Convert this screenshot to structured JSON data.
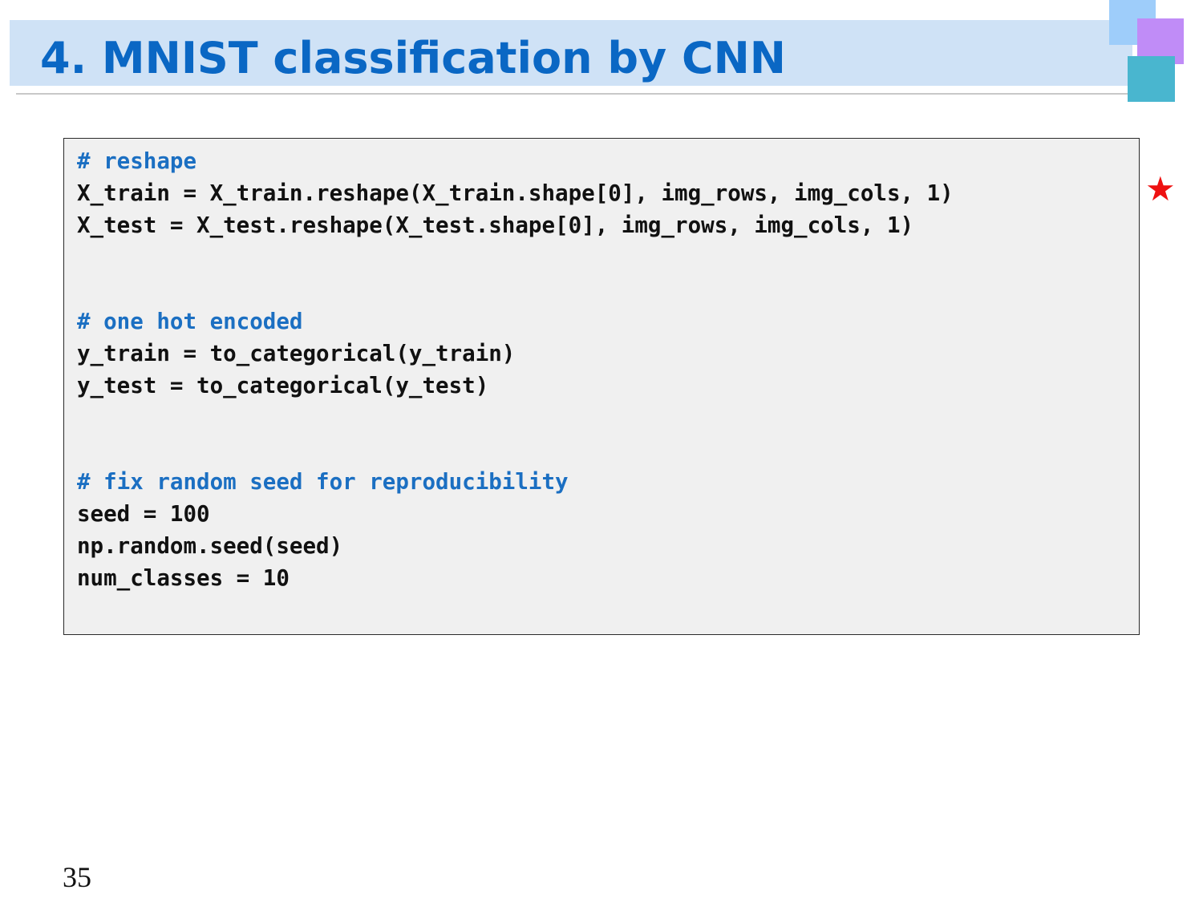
{
  "slide": {
    "title": "4. MNIST classification by CNN",
    "page_number": "35",
    "marker_symbol": "★",
    "colors": {
      "title_text": "#0a67c4",
      "title_band": "#cfe2f6",
      "comment_text": "#1b6fc2",
      "marker": "#ee1111",
      "deco_light_blue": "#9ecdfa",
      "deco_purple": "#c08cf7",
      "deco_teal": "#49b6cf"
    }
  },
  "code": {
    "lines": [
      "# reshape",
      "X_train = X_train.reshape(X_train.shape[0], img_rows, img_cols, 1)",
      "X_test = X_test.reshape(X_test.shape[0], img_rows, img_cols, 1)",
      "# one hot encoded",
      "y_train = to_categorical(y_train)",
      "y_test = to_categorical(y_test)",
      "# fix random seed for reproducibility",
      "seed = 100",
      "np.random.seed(seed)",
      "num_classes = 10"
    ]
  }
}
